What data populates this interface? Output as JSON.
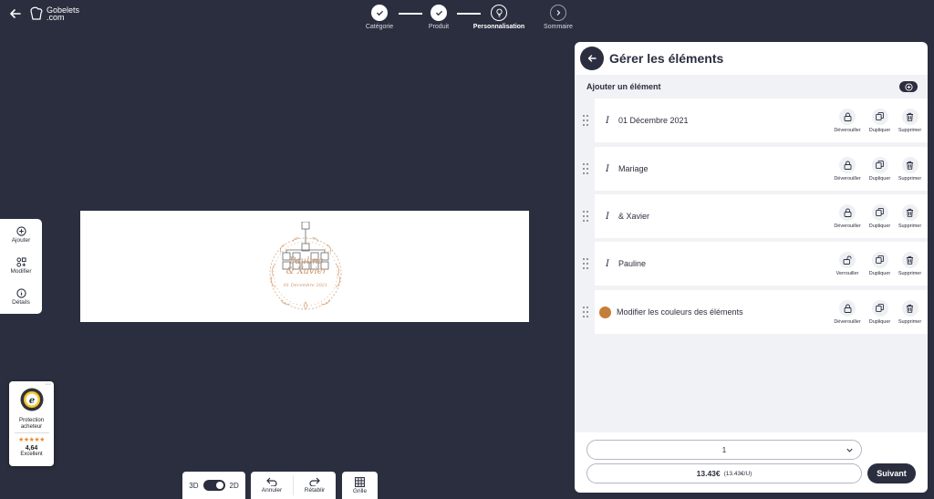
{
  "brand": {
    "logo_line1": "Gobelets",
    "logo_line2": ".com"
  },
  "stepper": {
    "steps": [
      {
        "label": "Catégorie",
        "state": "done"
      },
      {
        "label": "Produit",
        "state": "done"
      },
      {
        "label": "Personnalisation",
        "state": "current"
      },
      {
        "label": "Sommaire",
        "state": "todo"
      }
    ]
  },
  "side_menu": {
    "add": "Ajouter",
    "edit": "Modifier",
    "details": "Détails"
  },
  "design": {
    "names_line1": "Pauline",
    "names_line2": "& Xavier",
    "date": "01 Décembre 2021",
    "accent_color": "#c9956c"
  },
  "trust_badge": {
    "line1": "Protection",
    "line2": "acheteur",
    "stars": "★★★★★",
    "score": "4,64",
    "rating": "Excellent",
    "more": "···"
  },
  "toolbar": {
    "label_3d": "3D",
    "label_2d": "2D",
    "undo": "Annuler",
    "redo": "Rétablir",
    "grid": "Grille"
  },
  "panel": {
    "title": "Gérer les éléments",
    "add_element": "Ajouter un élément",
    "elements": [
      {
        "type": "text",
        "label": "01 Décembre 2021",
        "lock": "Déverouiller",
        "duplicate": "Dupliquer",
        "delete": "Supprimer"
      },
      {
        "type": "text",
        "label": "Mariage",
        "lock": "Déverouiller",
        "duplicate": "Dupliquer",
        "delete": "Supprimer"
      },
      {
        "type": "text",
        "label": "& Xavier",
        "lock": "Déverouiller",
        "duplicate": "Dupliquer",
        "delete": "Supprimer"
      },
      {
        "type": "text",
        "label": "Pauline",
        "lock": "Verrouiller",
        "duplicate": "Dupliquer",
        "delete": "Supprimer"
      },
      {
        "type": "color",
        "label": "Modifier les couleurs des éléments",
        "lock": "Déverouiller",
        "duplicate": "Dupliquer",
        "delete": "Supprimer",
        "swatch_color": "#c47e3a"
      }
    ],
    "quantity": "1",
    "price_main": "13.43€",
    "price_unit": "(13.43€/U)",
    "next": "Suivant"
  },
  "colors": {
    "background": "#2b2e3f",
    "panel_body": "#f1f2f5",
    "accent": "#c9956c"
  }
}
